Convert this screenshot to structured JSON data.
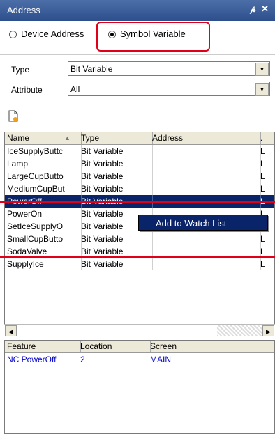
{
  "panel": {
    "title": "Address",
    "pin_glyph": "p",
    "close_glyph": "×"
  },
  "mode": {
    "device_address_label": "Device Address",
    "symbol_variable_label": "Symbol Variable",
    "selected": "Symbol Variable"
  },
  "filters": {
    "type_label": "Type",
    "type_value": "Bit Variable",
    "attribute_label": "Attribute",
    "attribute_value": "All"
  },
  "toolbar": {
    "new_icon": "new-document-icon"
  },
  "grid": {
    "columns": [
      "Name",
      "Type",
      "Address",
      "."
    ],
    "rows": [
      {
        "name": "IceSupplyButtc",
        "type": "Bit Variable",
        "address": "",
        "extra": "L"
      },
      {
        "name": "Lamp",
        "type": "Bit Variable",
        "address": "",
        "extra": "L"
      },
      {
        "name": "LargeCupButto",
        "type": "Bit Variable",
        "address": "",
        "extra": "L"
      },
      {
        "name": "MediumCupBut",
        "type": "Bit Variable",
        "address": "",
        "extra": "L"
      },
      {
        "name": "PowerOff",
        "type": "Bit Variable",
        "address": "",
        "extra": "L"
      },
      {
        "name": "PowerOn",
        "type": "Bit Variable",
        "address": "",
        "extra": "L"
      },
      {
        "name": "SetIceSupplyO",
        "type": "Bit Variable",
        "address": "",
        "extra": "L"
      },
      {
        "name": "SmallCupButto",
        "type": "Bit Variable",
        "address": "",
        "extra": "L"
      },
      {
        "name": "SodaValve",
        "type": "Bit Variable",
        "address": "",
        "extra": "L"
      },
      {
        "name": "SupplyIce",
        "type": "Bit Variable",
        "address": "",
        "extra": "L"
      }
    ],
    "selected_row": "PowerOff"
  },
  "context_menu": {
    "item": "Add to Watch List"
  },
  "usage": {
    "columns": [
      "Feature",
      "Location",
      "Screen"
    ],
    "rows": [
      {
        "feature": "NC PowerOff",
        "location": "2",
        "screen": "MAIN"
      }
    ]
  },
  "colors": {
    "accent_red": "#e0001a",
    "selection": "#0a246a",
    "link_blue": "#0000cc"
  }
}
